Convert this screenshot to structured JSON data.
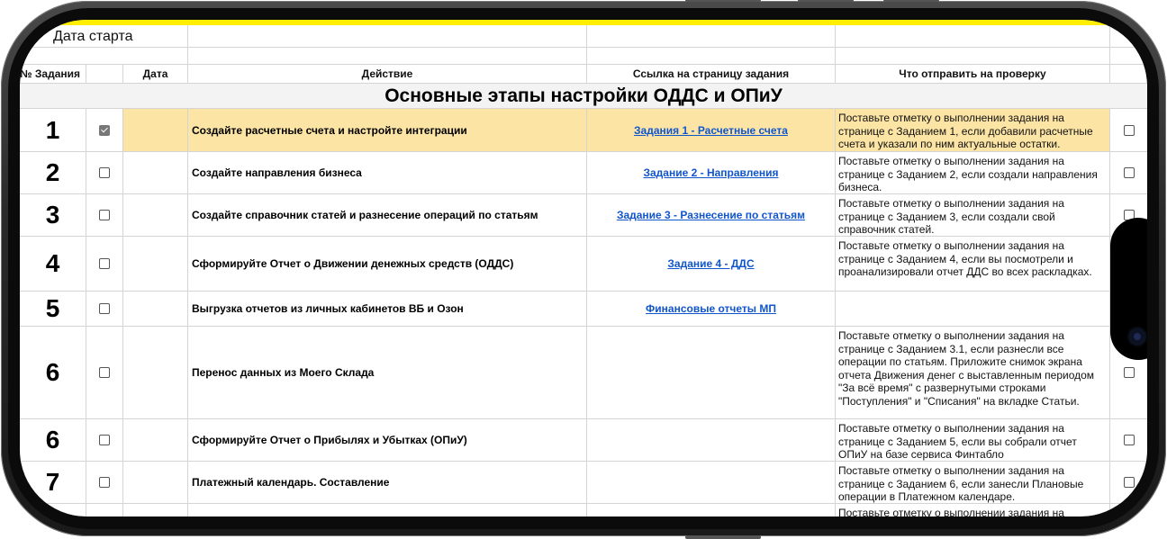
{
  "top_label": "Дата старта",
  "columns": [
    "№ Задания",
    "",
    "Дата",
    "Действие",
    "Ссылка на страницу задания",
    "Что отправить на проверку"
  ],
  "section_title": "Основные этапы настройки ОДДС и ОПиУ",
  "rows": [
    {
      "num": "1",
      "checked": true,
      "action": "Создайте расчетные счета и настройте интеграции",
      "link": "Задания 1 - Расчетные счета",
      "note": "Поставьте отметку о выполнении задания  на странице с Заданием 1, если добавили расчетные счета и указали по ним актуальные остатки."
    },
    {
      "num": "2",
      "checked": false,
      "action": "Создайте направления бизнеса",
      "link": "Задание 2 - Направления",
      "note": "Поставьте отметку о выполнении задания  на странице с Заданием 2, если создали направления бизнеса."
    },
    {
      "num": "3",
      "checked": false,
      "action": "Создайте справочник статей и разнесение операций по статьям",
      "link": "Задание 3 - Разнесение по статьям",
      "note": "Поставьте отметку о выполнении задания  на странице с Заданием 3, если создали свой справочник статей."
    },
    {
      "num": "4",
      "checked": false,
      "action": "Сформируйте Отчет о Движении денежных средств (ОДДС)",
      "link": "Задание 4  - ДДС",
      "note": "Поставьте отметку о выполнении задания на странице с Заданием 4, если вы посмотрели и проанализировали отчет ДДС во всех раскладках."
    },
    {
      "num": "5",
      "checked": false,
      "action": "Выгрузка отчетов из личных кабинетов ВБ и Озон",
      "link": "Финансовые отчеты МП",
      "note": ""
    },
    {
      "num": "6",
      "checked": false,
      "action": "Перенос данных из Моего Склада",
      "link": "",
      "note": "Поставьте отметку о выполнении задания  на странице с Заданием 3.1, если разнесли все операции по статьям. Приложите снимок экрана отчета Движения денег с выставленным периодом \"За всё время\" с развернутыми строками \"Поступления\" и \"Списания\" на вкладке Статьи."
    },
    {
      "num": "6",
      "checked": false,
      "action": "Сформируйте Отчет о Прибылях и Убытках (ОПиУ)",
      "link": "",
      "note": "Поставьте отметку о выполнении задания на странице с Заданием 5, если вы собрали отчет ОПиУ на базе сервиса Финтабло"
    },
    {
      "num": "7",
      "checked": false,
      "action": "Платежный календарь. Составление",
      "link": "",
      "note": "Поставьте отметку о выполнении задания на странице с Заданием 6, если занесли Плановые операции в Платежном календаре."
    },
    {
      "num": "",
      "checked": false,
      "action": "",
      "link": "",
      "note": "Поставьте отметку о выполнении задания на"
    }
  ]
}
